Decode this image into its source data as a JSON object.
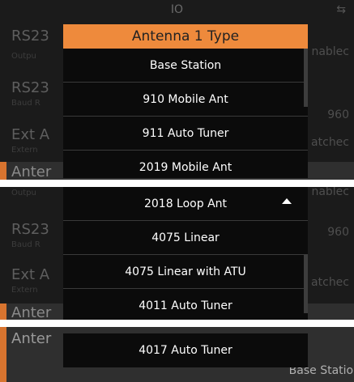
{
  "screen_title": "IO",
  "icons": {
    "top_right": "back-arrow-icon"
  },
  "background": {
    "p1_rows": [
      {
        "label": "RS23",
        "sub": "",
        "value": "nablec"
      },
      {
        "label": "",
        "sub": "Outpu",
        "value": ""
      },
      {
        "label": "RS23",
        "sub": "Baud R",
        "value": "960"
      },
      {
        "label": "Ext A",
        "sub": "Extern",
        "value": "atchec"
      },
      {
        "label": "Anter",
        "sub": "",
        "value": ""
      }
    ],
    "p2_rows": [
      {
        "label": "",
        "sub": "Outpu",
        "value": "nablec"
      },
      {
        "label": "RS23",
        "sub": "Baud R",
        "value": "960"
      },
      {
        "label": "Ext A",
        "sub": "Extern",
        "value": "atchec"
      },
      {
        "label": "Anter",
        "sub": "",
        "value": ""
      }
    ],
    "p3_rows": [
      {
        "label": "Anter",
        "sub": "",
        "value": "Base Station"
      }
    ]
  },
  "dropdown": {
    "header": "Antenna 1 Type",
    "view1": [
      "Base Station",
      "910 Mobile Ant",
      "911 Auto Tuner",
      "2019 Mobile Ant"
    ],
    "view2": [
      "2018 Loop Ant",
      "4075 Linear",
      "4075 Linear with ATU",
      "4011 Auto Tuner"
    ],
    "view3": [
      "4017 Auto Tuner"
    ]
  },
  "colors": {
    "accent": "#EE8A3C",
    "list_bg": "#0B0B0B",
    "screen_bg": "#1B1B1B"
  }
}
